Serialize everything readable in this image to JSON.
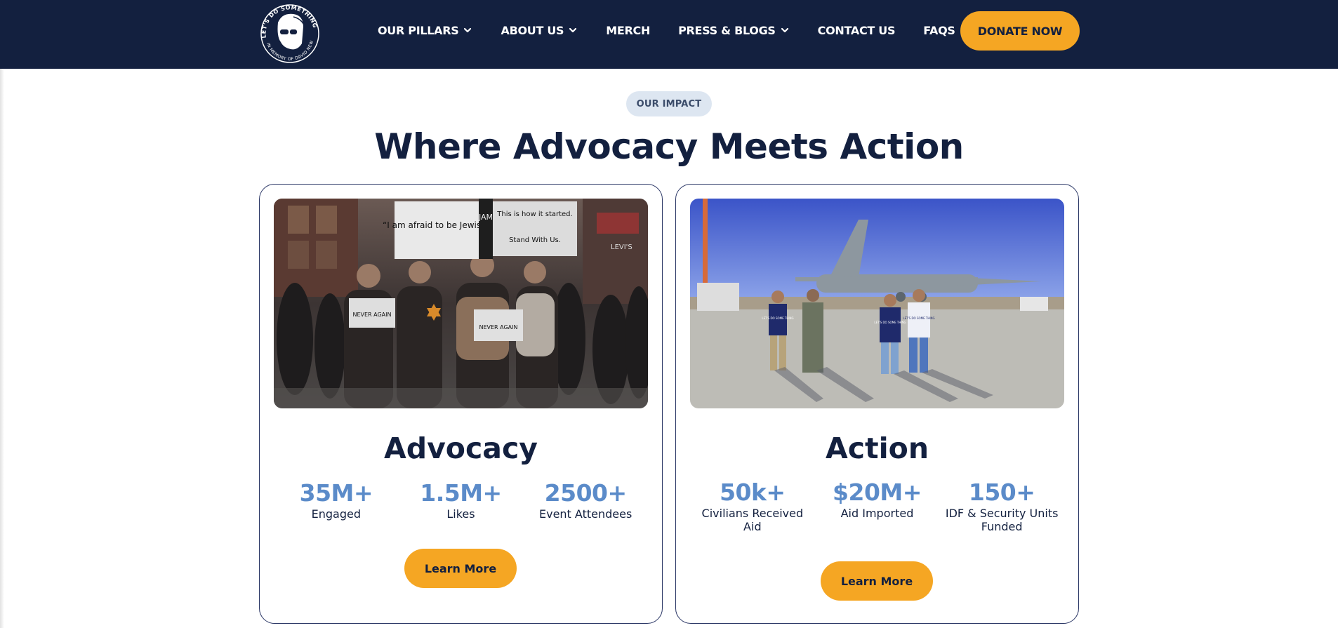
{
  "nav": {
    "logo_text_top": "LET'S DO SOMETHING",
    "logo_text_bottom": "IN MEMORY OF DAVID NEWMAN",
    "items": [
      {
        "label": "OUR PILLARS",
        "dropdown": true
      },
      {
        "label": "ABOUT US",
        "dropdown": true
      },
      {
        "label": "MERCH",
        "dropdown": false
      },
      {
        "label": "PRESS & BLOGS",
        "dropdown": true
      },
      {
        "label": "CONTACT US",
        "dropdown": false
      },
      {
        "label": "FAQS",
        "dropdown": false
      }
    ],
    "donate_label": "DONATE NOW"
  },
  "impact": {
    "pill": "OUR IMPACT",
    "title": "Where Advocacy Meets Action"
  },
  "cards": [
    {
      "heading": "Advocacy",
      "photo_signs": [
        "“I am afraid to be Jewish”",
        "This is how it started.",
        "Stand With Us.",
        "NEVER AGAIN",
        "NEVER AGAIN",
        "JAM",
        "LEVI'S"
      ],
      "stats": [
        {
          "value": "35M+",
          "label": "Engaged"
        },
        {
          "value": "1.5M+",
          "label": "Likes"
        },
        {
          "value": "2500+",
          "label": "Event Attendees"
        }
      ],
      "button": "Learn More"
    },
    {
      "heading": "Action",
      "photo_signs": [
        "LET'S DO SOME THING",
        "LET'S DO SOME THING",
        "LET'S DO SOME THING"
      ],
      "stats": [
        {
          "value": "50k+",
          "label": "Civilians Received Aid"
        },
        {
          "value": "$20M+",
          "label": "Aid Imported"
        },
        {
          "value": "150+",
          "label": "IDF & Security Units Funded"
        }
      ],
      "button": "Learn More"
    }
  ],
  "colors": {
    "navy": "#13203f",
    "accent": "#f5a623",
    "stat_blue": "#5b8bc9",
    "pill_bg": "#dde6f1"
  }
}
